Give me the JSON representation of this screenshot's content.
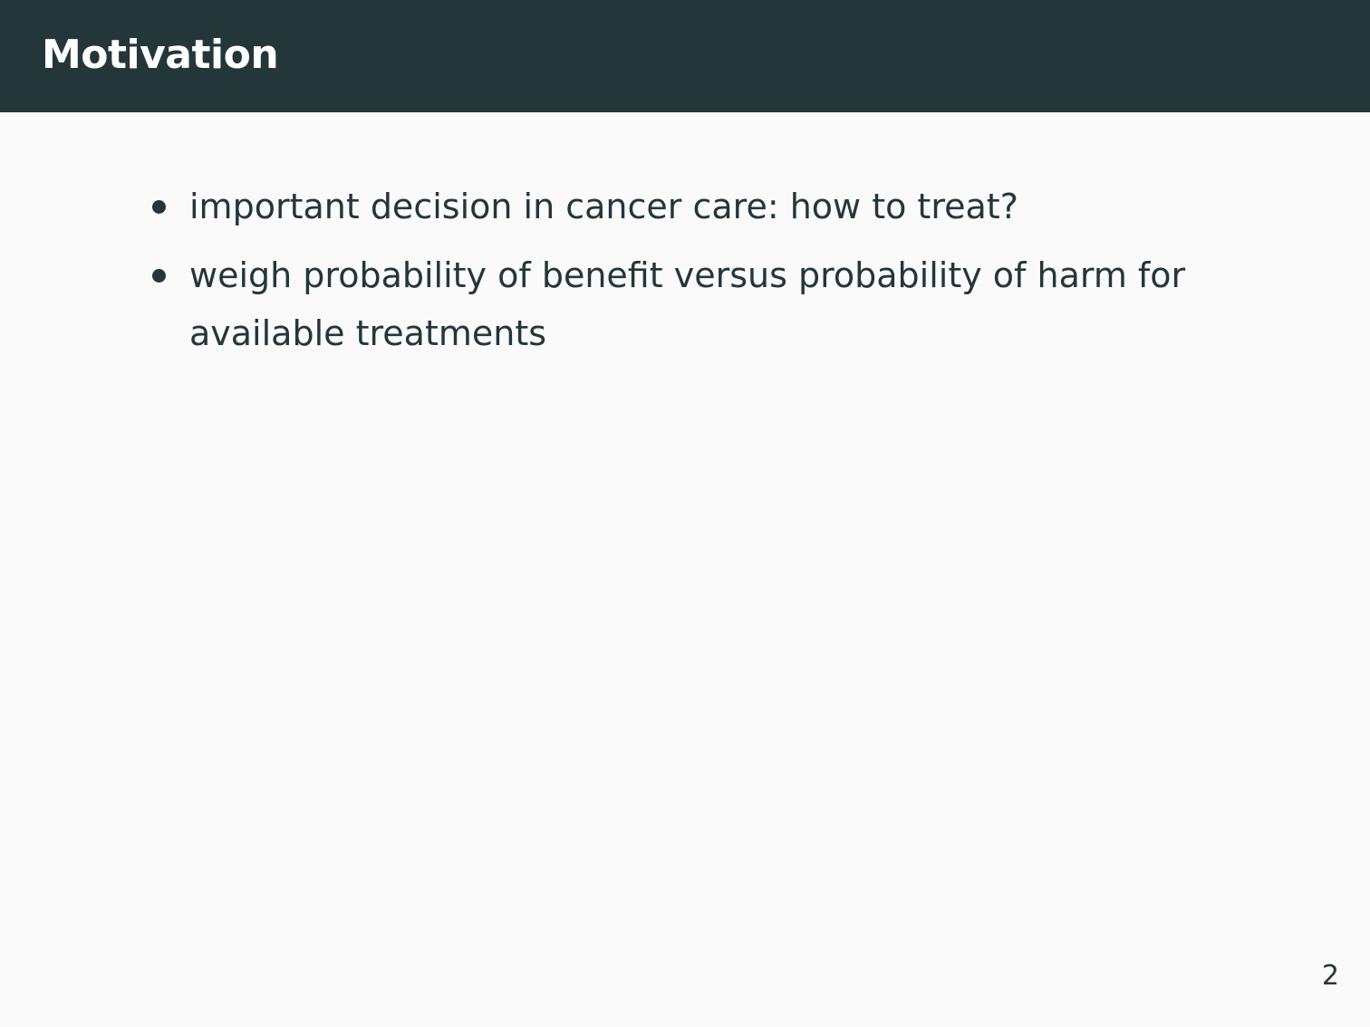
{
  "slide": {
    "title": "Motivation",
    "bullets": [
      {
        "text": "important decision in cancer care: how to treat?"
      },
      {
        "text": "weigh probability of benefit versus probability of harm for available treatments"
      }
    ],
    "page_number": "2"
  },
  "colors": {
    "title_bar": "#23373b",
    "background": "#fafafa",
    "text": "#23373b",
    "title_text": "#ffffff"
  }
}
